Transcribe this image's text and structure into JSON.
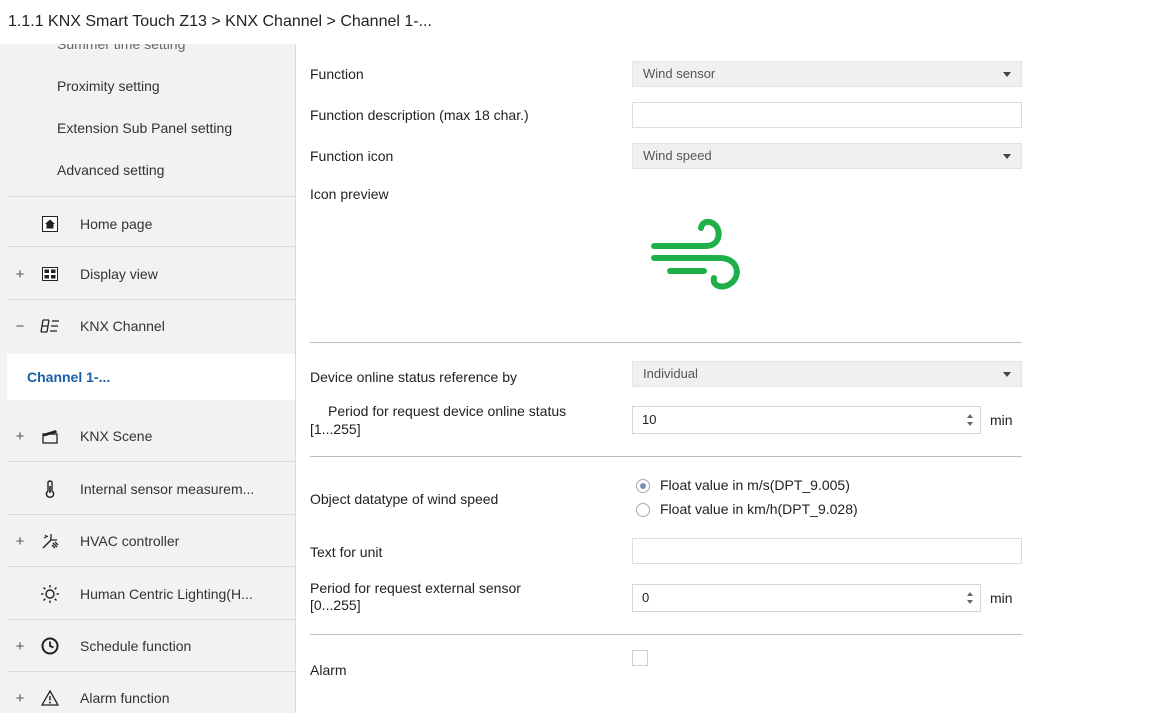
{
  "breadcrumb": "1.1.1 KNX Smart Touch Z13 > KNX Channel  > Channel 1-...",
  "sidebar": {
    "items": [
      {
        "label": "Summer time setting"
      },
      {
        "label": "Proximity setting"
      },
      {
        "label": "Extension Sub Panel setting"
      },
      {
        "label": "Advanced setting"
      },
      {
        "label": "Home page",
        "icon": "home-icon"
      },
      {
        "label": "Display view",
        "icon": "grid-icon",
        "expander": "+"
      },
      {
        "label": "KNX Channel",
        "icon": "channel-icon",
        "expander": "−"
      },
      {
        "label": "Channel 1-...",
        "selected": true
      },
      {
        "label": "KNX Scene",
        "icon": "scene-icon",
        "expander": "+"
      },
      {
        "label": "Internal sensor measurem...",
        "icon": "thermometer-icon"
      },
      {
        "label": "HVAC controller",
        "icon": "hvac-icon",
        "expander": "+"
      },
      {
        "label": "Human Centric Lighting(H...",
        "icon": "sun-icon"
      },
      {
        "label": "Schedule function",
        "icon": "clock-icon",
        "expander": "+"
      },
      {
        "label": "Alarm function",
        "icon": "warning-icon",
        "expander": "+"
      }
    ]
  },
  "form": {
    "function_label": "Function",
    "function_value": "Wind sensor",
    "description_label": "Function description (max 18 char.)",
    "description_value": "",
    "icon_label": "Function icon",
    "icon_value": "Wind speed",
    "preview_label": "Icon preview",
    "preview_icon": "wind-icon",
    "online_ref_label": "Device online status reference by",
    "online_ref_value": "Individual",
    "period_online_label_1": "Period for request device online status",
    "period_online_label_2": "[1...255]",
    "period_online_value": "10",
    "period_online_unit": "min",
    "datatype_label": "Object datatype of wind speed",
    "datatype_options": [
      "Float value in m/s(DPT_9.005)",
      "Float value in km/h(DPT_9.028)"
    ],
    "datatype_selected": "Float value in m/s(DPT_9.005)",
    "unit_text_label": "Text for unit",
    "unit_text_value": "",
    "period_ext_label_1": "Period for request external sensor",
    "period_ext_label_2": "[0...255]",
    "period_ext_value": "0",
    "period_ext_unit": "min",
    "alarm_label": "Alarm",
    "alarm_checked": false
  },
  "colors": {
    "accent": "#1a5ea8",
    "wind_icon": "#1fb04a"
  }
}
